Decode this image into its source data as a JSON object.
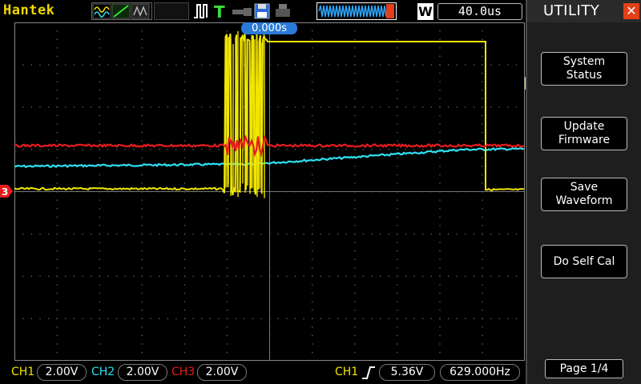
{
  "header": {
    "brand": "Hantek",
    "timebase": "40.0us",
    "window_mode": "W",
    "trigger_offset": "0.000s",
    "icons": [
      "waveform-mode-icon",
      "line-display-icon",
      "persist-icon",
      "pulse-trigger-icon",
      "trigger-t-icon",
      "usb-key-icon",
      "save-disk-icon",
      "printer-icon",
      "memory-waveform-icon"
    ]
  },
  "channels": [
    {
      "label": "CH1",
      "scale": "2.00V",
      "color": "#f2e600"
    },
    {
      "label": "CH2",
      "scale": "2.00V",
      "color": "#2ee0f0"
    },
    {
      "label": "CH3",
      "scale": "2.00V",
      "color": "#e81c1c"
    }
  ],
  "trigger": {
    "source": "CH1",
    "level": "5.36V",
    "frequency": "629.000Hz"
  },
  "menu": {
    "title": "UTILITY",
    "close_icon": "close-x-icon",
    "buttons": [
      {
        "label": "System\nStatus"
      },
      {
        "label": "Update\nFirmware"
      },
      {
        "label": "Save\nWaveform"
      },
      {
        "label": "Do Self Cal"
      }
    ],
    "page": "Page 1/4"
  },
  "markers": {
    "ch3_ground": "3"
  }
}
